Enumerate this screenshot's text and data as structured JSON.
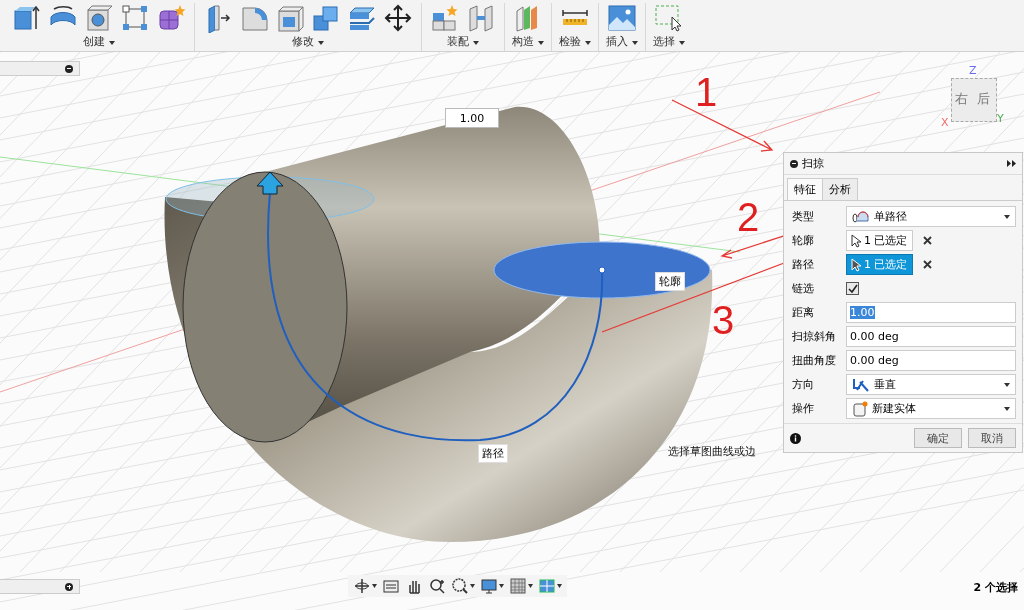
{
  "toolbar": {
    "groups": [
      {
        "label": "创建",
        "tools": [
          {
            "kind": "extrude"
          },
          {
            "kind": "revolve"
          },
          {
            "kind": "hole"
          },
          {
            "kind": "sketch"
          },
          {
            "kind": "form"
          }
        ]
      },
      {
        "label": "修改",
        "tools": [
          {
            "kind": "presspull"
          },
          {
            "kind": "fillet"
          },
          {
            "kind": "shell"
          },
          {
            "kind": "combine"
          },
          {
            "kind": "plane"
          },
          {
            "kind": "move"
          }
        ]
      },
      {
        "label": "装配",
        "tools": [
          {
            "kind": "component"
          },
          {
            "kind": "joint"
          }
        ]
      },
      {
        "label": "构造",
        "tools": [
          {
            "kind": "construct"
          }
        ]
      },
      {
        "label": "检验",
        "tools": [
          {
            "kind": "measure"
          }
        ]
      },
      {
        "label": "插入",
        "tools": [
          {
            "kind": "image"
          }
        ]
      },
      {
        "label": "选择",
        "tools": [
          {
            "kind": "select"
          }
        ]
      }
    ]
  },
  "viewcube": {
    "axes": [
      "Z",
      "X",
      "Y"
    ],
    "faces": [
      "右",
      "后"
    ]
  },
  "viewport": {
    "value_box": "1.00",
    "profile_tag": "轮廓",
    "path_tag": "路径",
    "prompt": "选择草图曲线或边",
    "status": "2 个选择"
  },
  "annotations": [
    "1",
    "2",
    "3"
  ],
  "dialog": {
    "title": "扫掠",
    "tabs": [
      {
        "label": "特征",
        "selected": true
      },
      {
        "label": "分析",
        "selected": false
      }
    ],
    "rows": [
      {
        "kind": "dropdown",
        "label": "类型",
        "value": "单路径"
      },
      {
        "kind": "selection",
        "label": "轮廓",
        "value": "1 已选定",
        "active": false
      },
      {
        "kind": "selection",
        "label": "路径",
        "value": "1 已选定",
        "active": true
      },
      {
        "kind": "checkbox",
        "label": "链选",
        "checked": true
      },
      {
        "kind": "input",
        "label": "距离",
        "value": "1.00",
        "highlighted": true
      },
      {
        "kind": "input",
        "label": "扫掠斜角",
        "value": "0.00 deg",
        "highlighted": false
      },
      {
        "kind": "input",
        "label": "扭曲角度",
        "value": "0.00 deg",
        "highlighted": false
      },
      {
        "kind": "dropdown",
        "label": "方向",
        "value": "垂直"
      },
      {
        "kind": "dropdown",
        "label": "操作",
        "value": "新建实体"
      }
    ],
    "buttons": [
      "确定",
      "取消"
    ]
  },
  "nav_bar": {
    "tools": [
      {
        "kind": "orbit",
        "menu": true
      },
      {
        "kind": "look",
        "menu": false
      },
      {
        "kind": "pan",
        "menu": false
      },
      {
        "kind": "zoom",
        "menu": false
      },
      {
        "kind": "fit",
        "menu": true
      },
      {
        "kind": "display",
        "menu": true
      },
      {
        "kind": "grid",
        "menu": true
      },
      {
        "kind": "viewports",
        "menu": true
      }
    ]
  }
}
